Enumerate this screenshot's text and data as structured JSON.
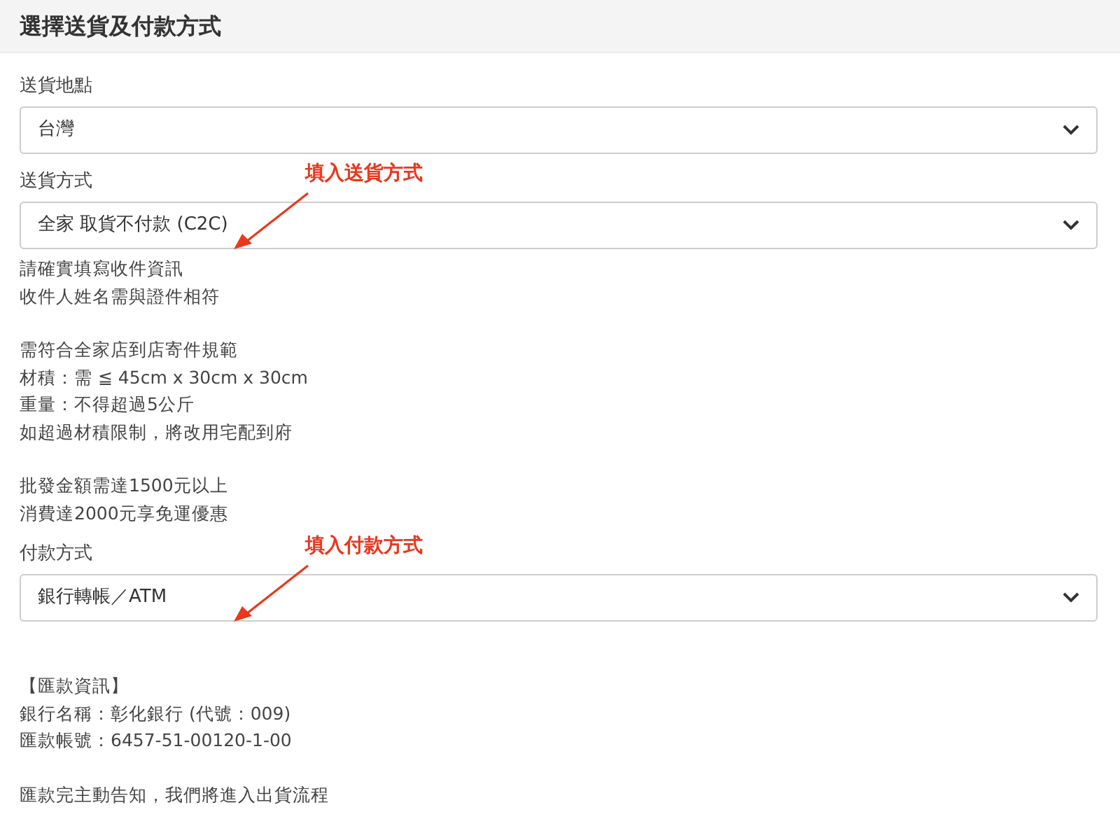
{
  "header": {
    "title": "選擇送貨及付款方式"
  },
  "fields": [
    {
      "label": "送貨地點",
      "value": "台灣"
    },
    {
      "label": "送貨方式",
      "value": "全家 取貨不付款 (C2C)",
      "annotation": "填入送貨方式",
      "notes": [
        [
          "請確實填寫收件資訊",
          "收件人姓名需與證件相符"
        ],
        [
          "需符合全家店到店寄件規範",
          "材積：需 ≦ 45cm x 30cm x 30cm",
          "重量：不得超過5公斤",
          "如超過材積限制，將改用宅配到府"
        ],
        [
          "批發金額需達1500元以上",
          "消費達2000元享免運優惠"
        ]
      ]
    },
    {
      "label": "付款方式",
      "value": "銀行轉帳／ATM",
      "annotation": "填入付款方式",
      "notes": [
        [
          "【匯款資訊】",
          "銀行名稱：彰化銀行 (代號：009)",
          "匯款帳號：6457-51-00120-1-00"
        ],
        [
          "匯款完主動告知，我們將進入出貨流程"
        ]
      ]
    }
  ]
}
